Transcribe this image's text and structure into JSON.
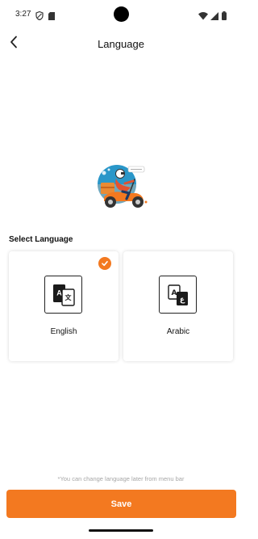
{
  "status_bar": {
    "time": "3:27",
    "icons": [
      "shield-icon",
      "sim-card-icon",
      "wifi-icon",
      "signal-icon",
      "battery-icon"
    ]
  },
  "header": {
    "title": "Language",
    "back_icon": "chevron-left-icon"
  },
  "illustration": "delivery-scooter-illustration",
  "section_label": "Select Language",
  "languages": [
    {
      "label": "English",
      "icon": "translate-icon",
      "selected": true
    },
    {
      "label": "Arabic",
      "icon": "translate-arabic-icon",
      "selected": false
    }
  ],
  "hint": "*You can change language later from menu bar",
  "save_label": "Save",
  "colors": {
    "accent": "#f37920",
    "hint": "#a6a6a6",
    "text": "#111111"
  }
}
